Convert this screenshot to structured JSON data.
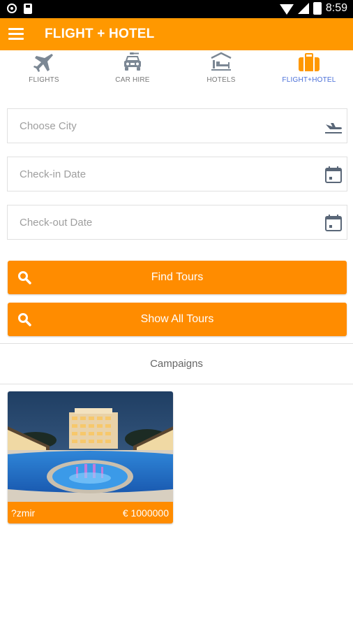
{
  "status_bar": {
    "time": "8:59"
  },
  "app_bar": {
    "title": "FLIGHT + HOTEL",
    "menu_icon": "hamburger-menu-icon"
  },
  "tabs": [
    {
      "label": "FLIGHTS",
      "icon": "airplane-icon",
      "active": false
    },
    {
      "label": "CAR HIRE",
      "icon": "car-icon",
      "active": false
    },
    {
      "label": "HOTELS",
      "icon": "hotel-icon",
      "active": false
    },
    {
      "label": "FLIGHT+HOTEL",
      "icon": "suitcase-icon",
      "active": true
    }
  ],
  "form": {
    "city_placeholder": "Choose City",
    "checkin_placeholder": "Check-in Date",
    "checkout_placeholder": "Check-out Date"
  },
  "buttons": {
    "find_tours": "Find Tours",
    "show_all_tours": "Show All Tours"
  },
  "campaigns": {
    "title": "Campaigns",
    "items": [
      {
        "city": "?zmir",
        "price": "€ 1000000"
      }
    ]
  },
  "colors": {
    "accent": "#ff9800",
    "button": "#ff8c00",
    "active_tab": "#4a6fd8",
    "inactive_icon": "#7b8794"
  }
}
